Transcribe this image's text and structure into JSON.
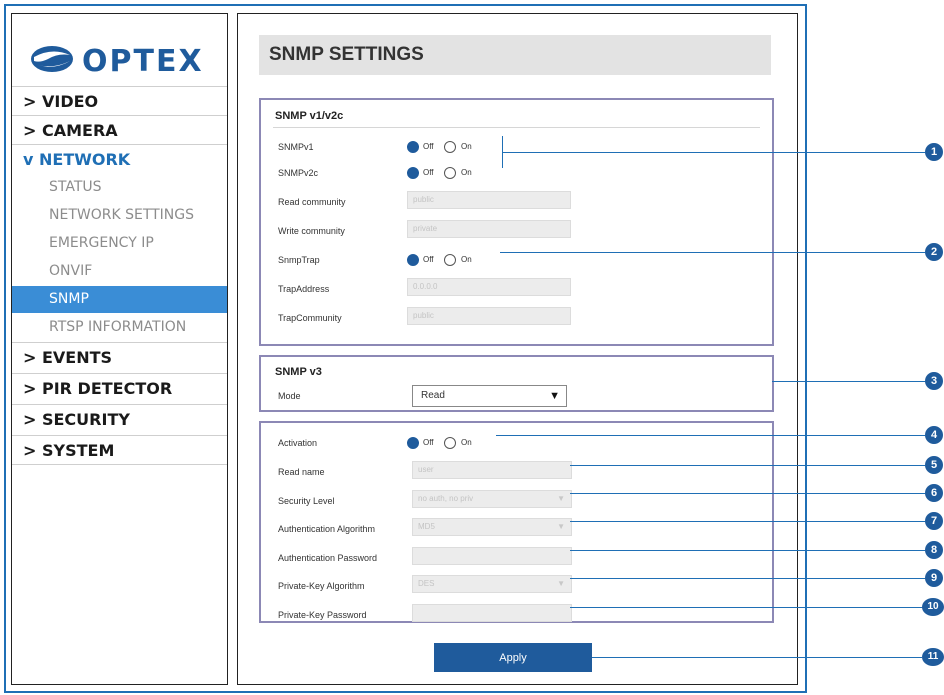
{
  "sidebar": {
    "logo_text": "OPTEX",
    "menu": [
      {
        "label": "> VIDEO"
      },
      {
        "label": "> CAMERA"
      },
      {
        "label": "v NETWORK"
      },
      {
        "label": "> EVENTS"
      },
      {
        "label": "> PIR DETECTOR"
      },
      {
        "label": "> SECURITY"
      },
      {
        "label": "> SYSTEM"
      }
    ],
    "network_items": [
      {
        "label": "STATUS"
      },
      {
        "label": "NETWORK SETTINGS"
      },
      {
        "label": "EMERGENCY IP"
      },
      {
        "label": "ONVIF"
      },
      {
        "label": "SNMP"
      },
      {
        "label": "RTSP INFORMATION"
      }
    ]
  },
  "page": {
    "title": "SNMP SETTINGS"
  },
  "v1v2c": {
    "title": "SNMP v1/v2c",
    "snmpv1_label": "SNMPv1",
    "snmpv2c_label": "SNMPv2c",
    "read_community_label": "Read community",
    "read_community_value": "public",
    "write_community_label": "Write community",
    "write_community_value": "private",
    "snmptrap_label": "SnmpTrap",
    "trapaddress_label": "TrapAddress",
    "trapaddress_value": "0.0.0.0",
    "trapcommunity_label": "TrapCommunity",
    "trapcommunity_value": "public"
  },
  "radio": {
    "off": "Off",
    "on": "On"
  },
  "v3": {
    "title": "SNMP v3",
    "mode_label": "Mode",
    "mode_value": "Read"
  },
  "v3_settings": {
    "activation_label": "Activation",
    "read_name_label": "Read name",
    "read_name_value": "user",
    "security_level_label": "Security Level",
    "security_level_value": "no auth, no priv",
    "auth_algorithm_label": "Authentication Algorithm",
    "auth_algorithm_value": "MD5",
    "auth_password_label": "Authentication Password",
    "privkey_algorithm_label": "Private-Key Algorithm",
    "privkey_algorithm_value": "DES",
    "privkey_password_label": "Private-Key Password"
  },
  "apply_label": "Apply",
  "callouts": [
    "1",
    "2",
    "3",
    "4",
    "5",
    "6",
    "7",
    "8",
    "9",
    "10",
    "11"
  ],
  "colors": {
    "accent": "#1f6fb5",
    "button": "#1f5b9c",
    "selected": "#3a8dd6",
    "section_border": "#8c88b5"
  }
}
